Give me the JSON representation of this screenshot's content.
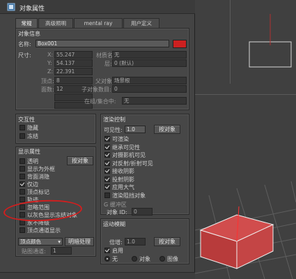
{
  "window": {
    "title": "对象属性"
  },
  "tabs": [
    {
      "label": "常规",
      "active": true
    },
    {
      "label": "高级照明",
      "active": false
    },
    {
      "label": "mental ray",
      "active": false
    },
    {
      "label": "用户定义",
      "active": false
    }
  ],
  "object_info": {
    "group_title": "对象信息",
    "name_label": "名称:",
    "name_value": "Box001",
    "color": "#cc2020",
    "dimensions_label": "尺寸:",
    "x_label": "X:",
    "x_value": "55.247",
    "y_label": "Y:",
    "y_value": "54.137",
    "z_label": "Z:",
    "z_value": "22.391",
    "vertices_label": "顶点:",
    "vertices_value": "8",
    "faces_label": "面数:",
    "faces_value": "12",
    "material_name_label": "材质名:",
    "material_name_value": "无",
    "layer_label": "层:",
    "layer_value": "0 (默认)",
    "parent_label": "父对象:",
    "parent_value": "场景根",
    "children_label": "子对象数目:",
    "children_value": "0",
    "group_label": "在组/集合中:",
    "group_value": "无"
  },
  "interactivity": {
    "group_title": "交互性",
    "hide_label": "隐藏",
    "freeze_label": "冻结"
  },
  "display_props": {
    "group_title": "显示属性",
    "by_object_button": "按对象",
    "items": [
      {
        "label": "透明",
        "checked": false
      },
      {
        "label": "显示为外框",
        "checked": false
      },
      {
        "label": "背面消隐",
        "checked": false
      },
      {
        "label": "仅边",
        "checked": true
      },
      {
        "label": "顶点标记",
        "checked": false
      },
      {
        "label": "轨迹",
        "checked": false
      },
      {
        "label": "忽略范围",
        "checked": false
      },
      {
        "label": "以灰色显示冻结对象",
        "checked": false
      },
      {
        "label": "永不降级",
        "checked": false
      },
      {
        "label": "顶点通道显示",
        "checked": false
      }
    ],
    "vertex_color_value": "顶点颜色",
    "shading_button": "明暗处理",
    "map_channel_label": "贴图通道:",
    "map_channel_value": "1"
  },
  "render_control": {
    "group_title": "渲染控制",
    "visibility_label": "可见性:",
    "visibility_value": "1.0",
    "by_object_button": "按对象",
    "items": [
      {
        "label": "可渲染",
        "checked": true
      },
      {
        "label": "继承可见性",
        "checked": true
      },
      {
        "label": "对摄影机可见",
        "checked": true
      },
      {
        "label": "对反射/折射可见",
        "checked": true
      },
      {
        "label": "接收阴影",
        "checked": true
      },
      {
        "label": "投射阴影",
        "checked": true
      },
      {
        "label": "应用大气",
        "checked": true
      },
      {
        "label": "渲染阻挡对象",
        "checked": false
      }
    ],
    "gbuffer_title": "G 缓冲区",
    "object_id_label": "对象 ID:",
    "object_id_value": "0"
  },
  "motion_blur": {
    "group_title": "运动模糊",
    "multiplier_label": "倍增:",
    "multiplier_value": "1.0",
    "by_object_button": "按对象",
    "enable_label": "启用",
    "none_label": "无",
    "object_label": "对象",
    "image_label": "图像"
  }
}
